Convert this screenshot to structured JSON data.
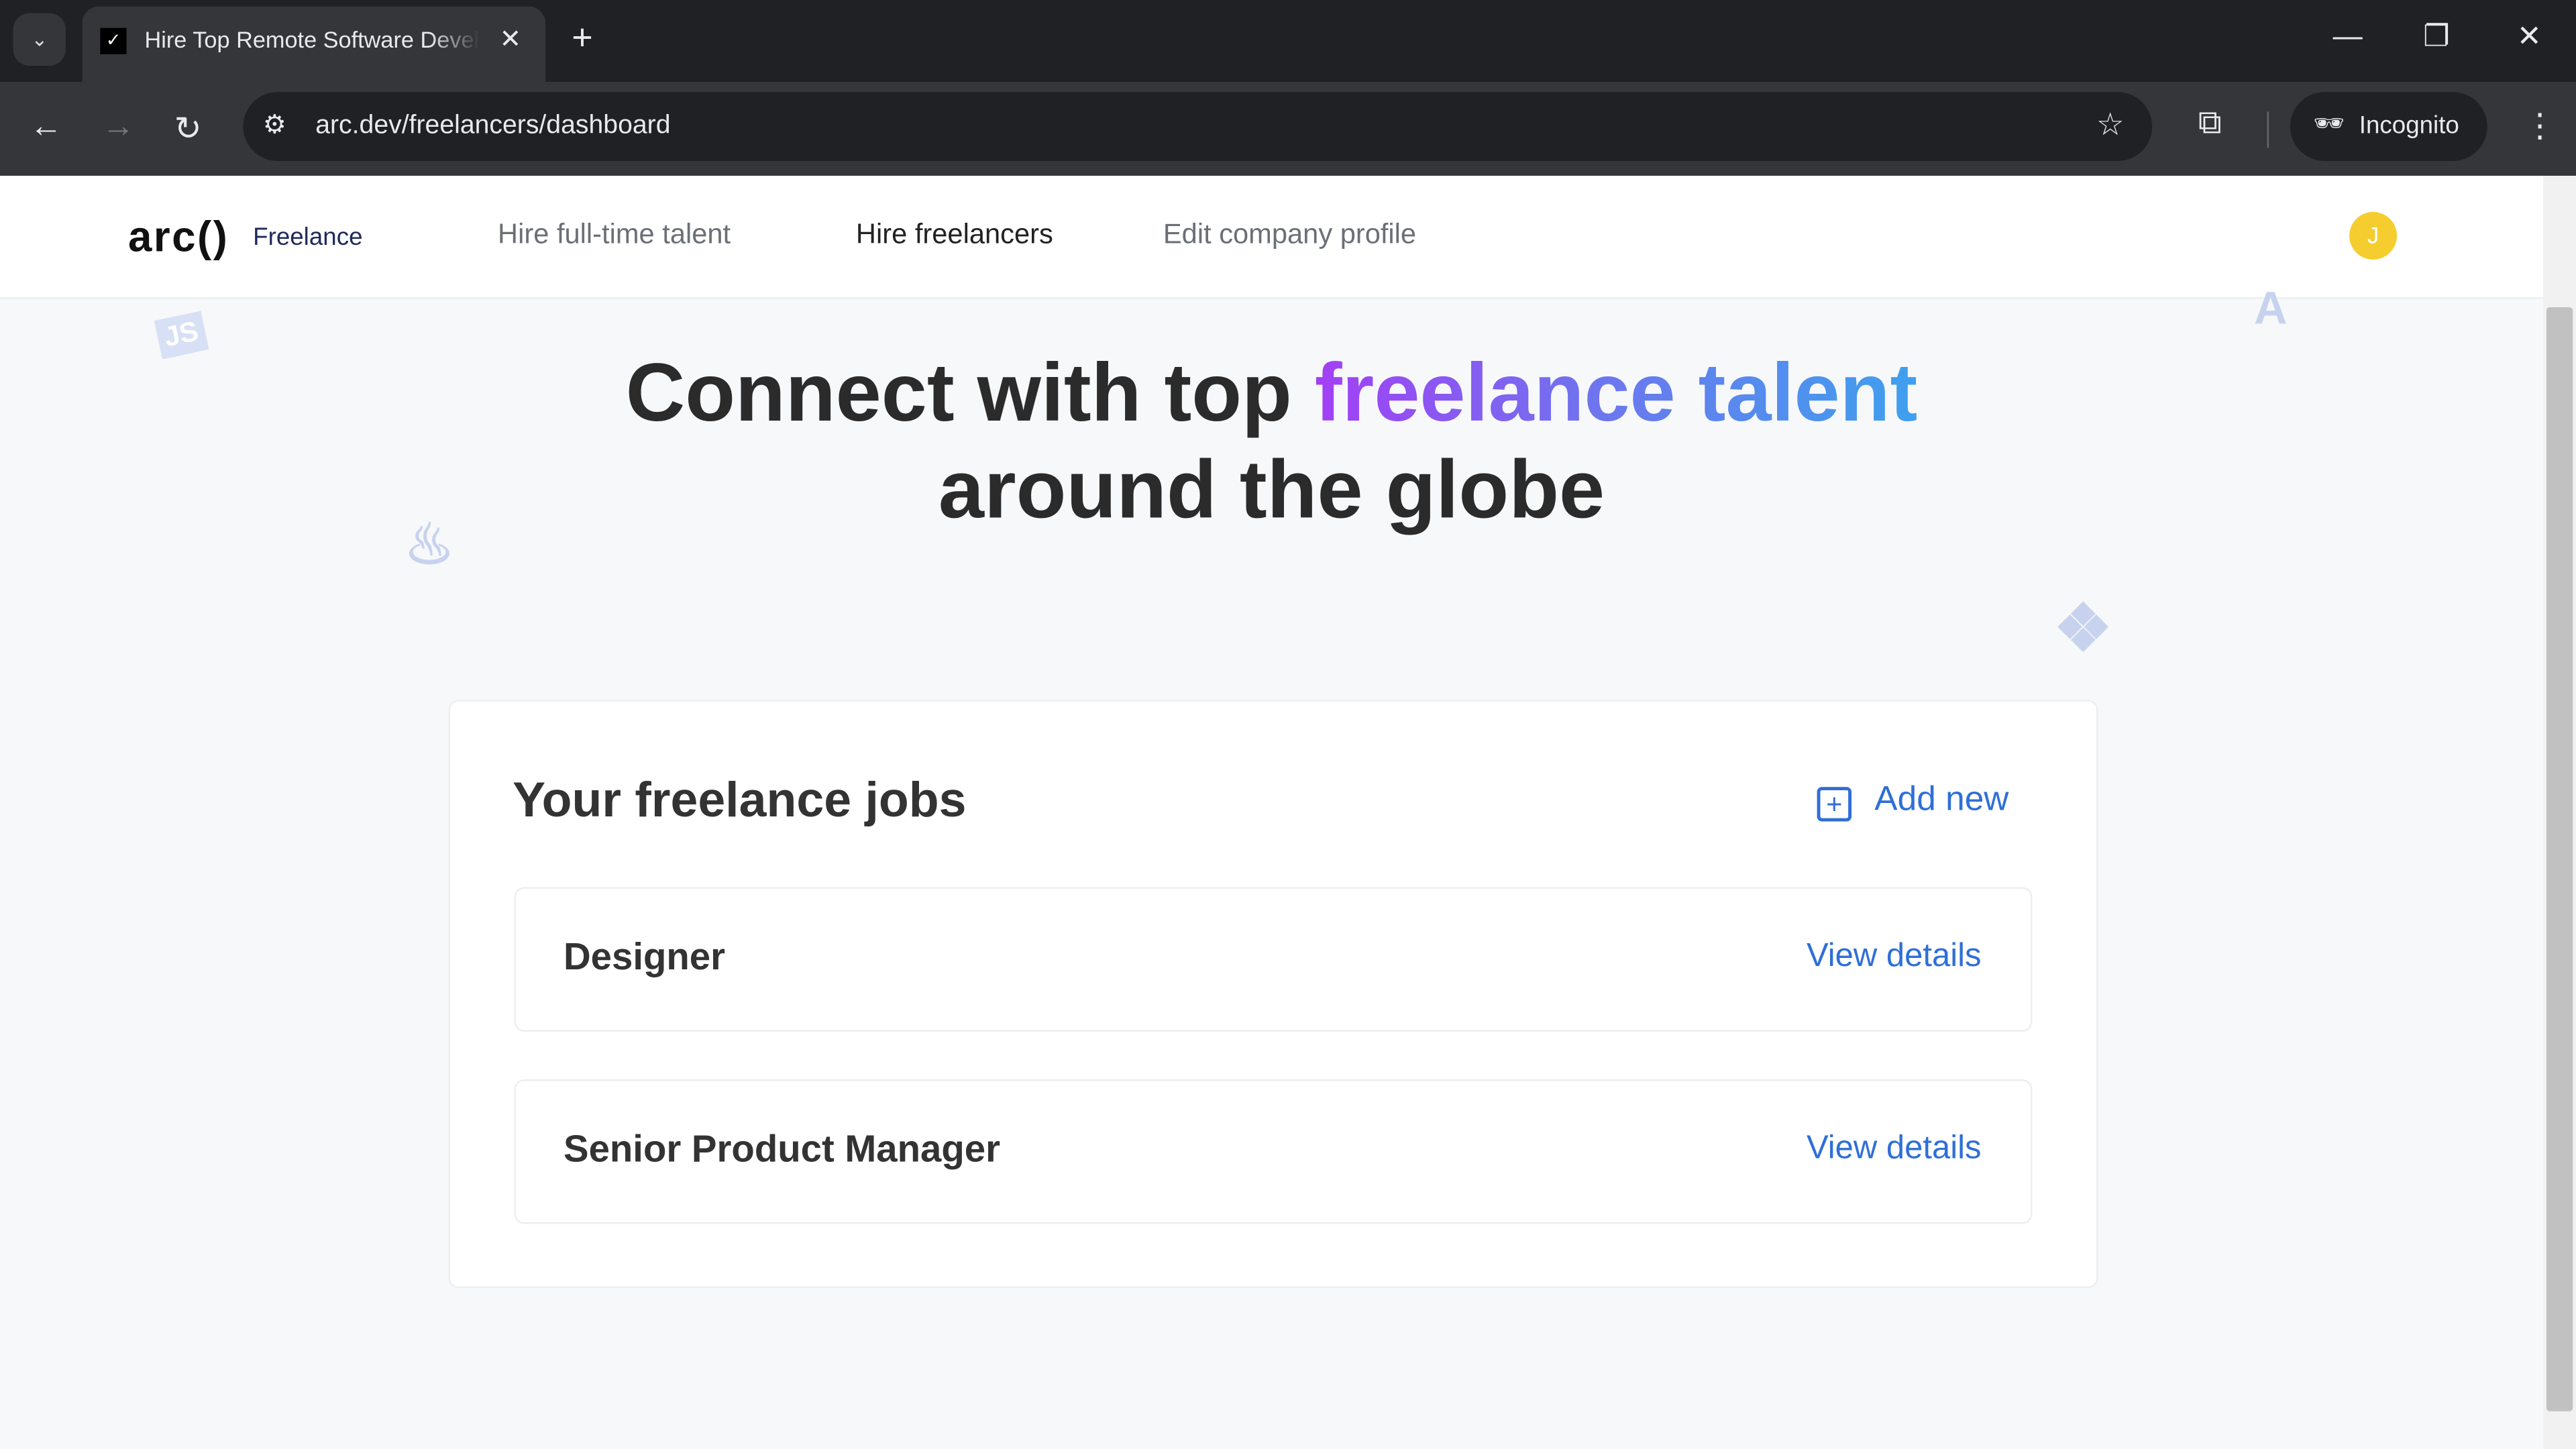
{
  "browser": {
    "tab_title": "Hire Top Remote Software Developers",
    "url": "arc.dev/freelancers/dashboard",
    "incognito_label": "Incognito"
  },
  "header": {
    "logo": "arc()",
    "logo_sub": "Freelance",
    "nav": [
      "Hire full-time talent",
      "Hire freelancers",
      "Edit company profile"
    ],
    "avatar_initial": "J",
    "avatar_color": "#f5cd2e"
  },
  "hero": {
    "line1_prefix": "Connect with top ",
    "line1_highlight": "freelance talent",
    "line2": "around the globe",
    "decor": {
      "js": "JS",
      "angular": "A"
    }
  },
  "jobs": {
    "title": "Your freelance jobs",
    "add_new": "Add new",
    "items": [
      {
        "name": "Designer",
        "action": "View details"
      },
      {
        "name": "Senior Product Manager",
        "action": "View details"
      }
    ]
  },
  "colors": {
    "link": "#2f6fd6",
    "gradient_start": "#a33ff5",
    "gradient_end": "#3fa0ee"
  }
}
